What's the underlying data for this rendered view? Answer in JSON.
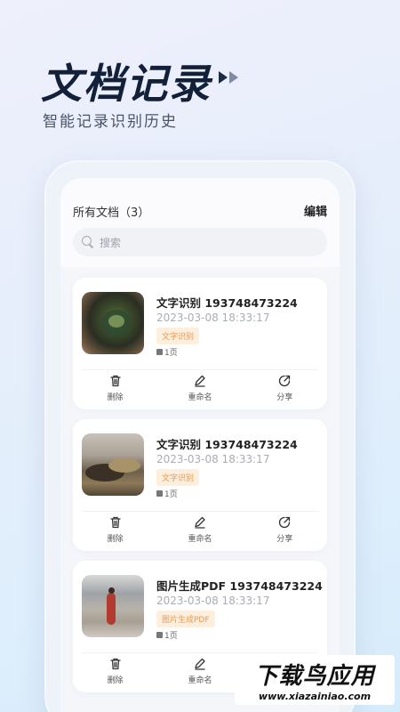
{
  "hero": {
    "title": "文档记录",
    "subtitle": "智能记录识别历史"
  },
  "header": {
    "doc_count": "所有文档（3）",
    "edit_label": "编辑"
  },
  "search": {
    "placeholder": "搜索"
  },
  "documents": [
    {
      "title": "文字识别 193748473224",
      "date": "2023-03-08 18:33:17",
      "tag": "文字识别",
      "pages": "1页"
    },
    {
      "title": "文字识别 193748473224",
      "date": "2023-03-08 18:33:17",
      "tag": "文字识别",
      "pages": "1页"
    },
    {
      "title": "图片生成PDF 193748473224",
      "date": "2023-03-08 18:33:17",
      "tag": "图片生成PDF",
      "pages": "1页"
    }
  ],
  "actions": {
    "delete": "删除",
    "rename": "重命名",
    "share": "分享"
  },
  "watermark": {
    "brand": "下载鸟应用",
    "url": "www.xiazainiao.com"
  },
  "colors": {
    "tag_text": "#e79a50",
    "tag_bg": "#fdeedd",
    "title": "#13203a"
  }
}
